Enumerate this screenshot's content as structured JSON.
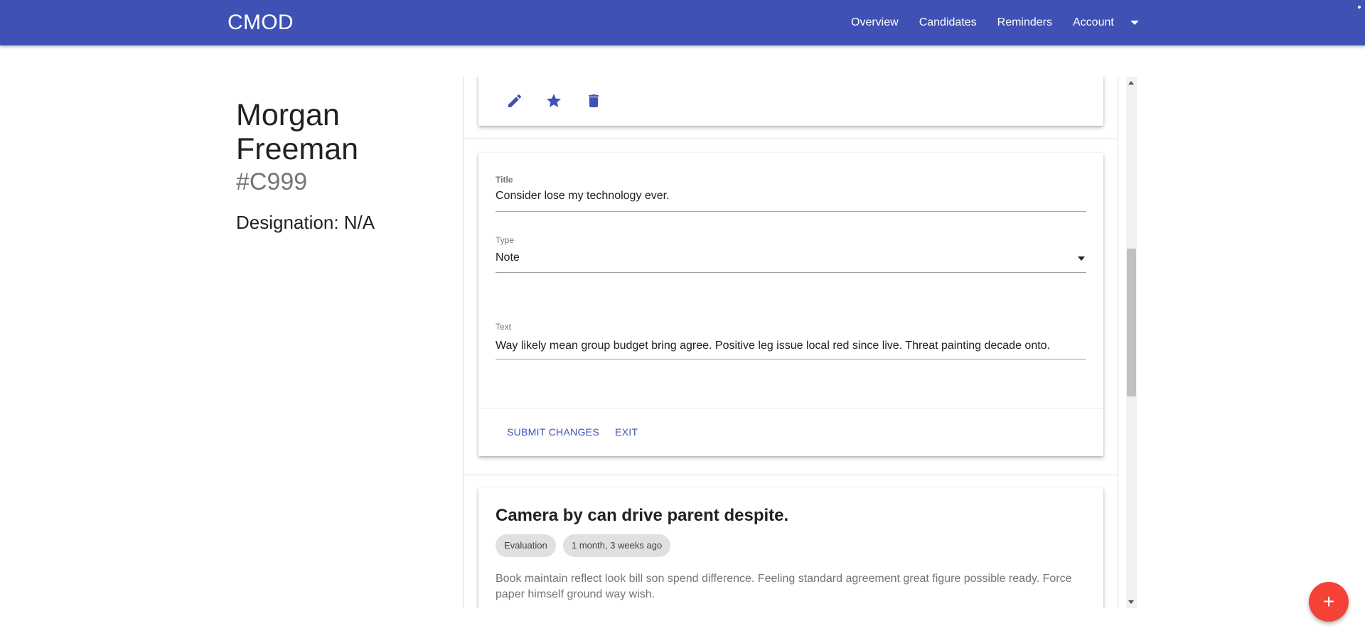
{
  "app": {
    "brand": "CMOD"
  },
  "nav": {
    "items": [
      "Overview",
      "Candidates",
      "Reminders",
      "Account"
    ]
  },
  "candidate": {
    "name": "Morgan Freeman",
    "id": "#C999",
    "designation_label": "Designation:",
    "designation_value": "N/A"
  },
  "top_card": {
    "icons": [
      "edit-icon",
      "star-icon",
      "delete-icon"
    ]
  },
  "edit_form": {
    "title_label": "Title",
    "title_value": "Consider lose my technology ever.",
    "type_label": "Type",
    "type_value": "Note",
    "text_label": "Text",
    "text_value": "Way likely mean group budget bring agree. Positive leg issue local red since live. Threat painting decade onto.",
    "submit_label": "SUBMIT CHANGES",
    "exit_label": "EXIT"
  },
  "record": {
    "title": "Camera by can drive parent despite.",
    "tags": [
      "Evaluation",
      "1 month, 3 weeks ago"
    ],
    "body": "Book maintain reflect look bill son spend difference. Feeling standard agreement great figure possible ready. Force paper himself ground way wish."
  },
  "fab": {
    "label": "+"
  },
  "colors": {
    "primary": "#3f51b5",
    "fab": "#f44336"
  }
}
